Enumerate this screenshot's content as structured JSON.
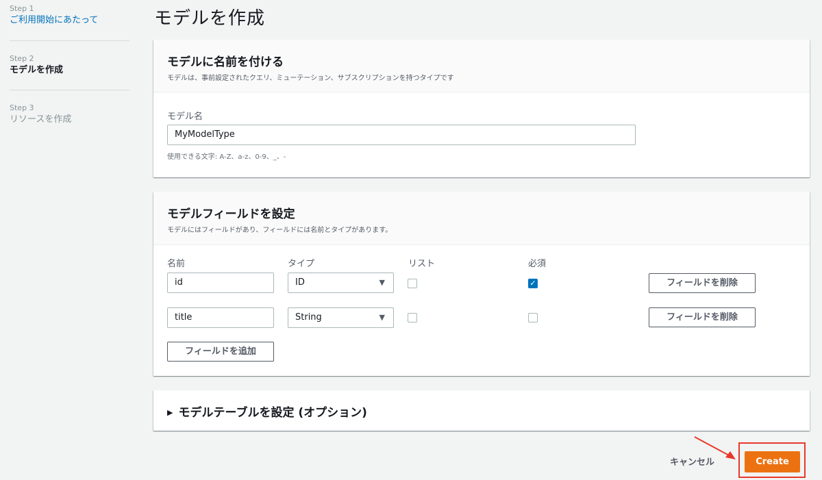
{
  "sidebar": {
    "steps": [
      {
        "num": "Step 1",
        "title": "ご利用開始にあたって"
      },
      {
        "num": "Step 2",
        "title": "モデルを作成"
      },
      {
        "num": "Step 3",
        "title": "リソースを作成"
      }
    ]
  },
  "page_title": "モデルを作成",
  "name_panel": {
    "title": "モデルに名前を付ける",
    "desc": "モデルは、事前設定されたクエリ、ミューテーション、サブスクリプションを持つタイプです",
    "field_label": "モデル名",
    "field_value": "MyModelType",
    "hint": "使用できる文字: A-Z、a-z、0-9、_、-"
  },
  "fields_panel": {
    "title": "モデルフィールドを設定",
    "desc": "モデルにはフィールドがあり、フィールドには名前とタイプがあります。",
    "columns": {
      "name": "名前",
      "type": "タイプ",
      "list": "リスト",
      "required": "必須"
    },
    "rows": [
      {
        "name": "id",
        "type": "ID",
        "list": false,
        "required": true,
        "remove_label": "フィールドを削除"
      },
      {
        "name": "title",
        "type": "String",
        "list": false,
        "required": false,
        "remove_label": "フィールドを削除"
      }
    ],
    "add_label": "フィールドを追加"
  },
  "table_panel": {
    "title": "モデルテーブルを設定 (オプション)"
  },
  "footer": {
    "cancel_label": "キャンセル",
    "create_label": "Create"
  },
  "colors": {
    "accent": "#ec7211",
    "link": "#0073bb",
    "annotation": "#e8382a"
  }
}
